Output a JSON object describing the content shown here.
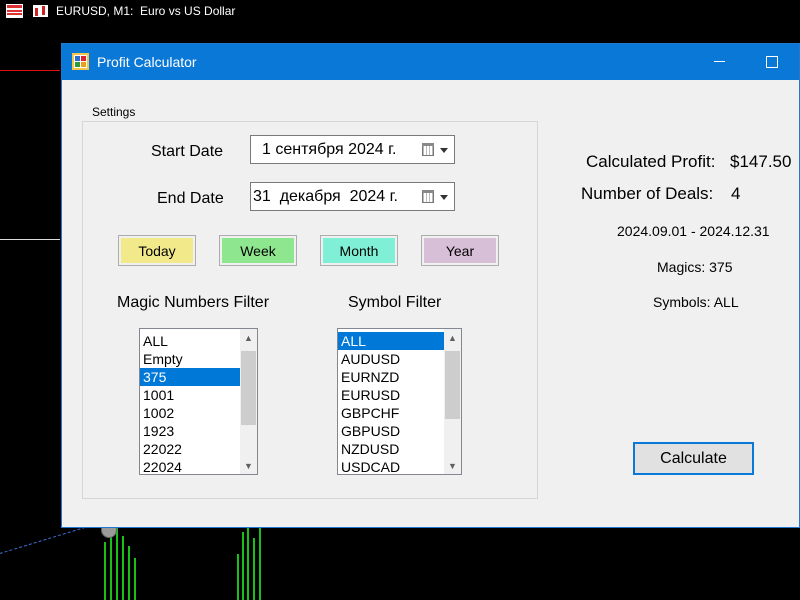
{
  "terminal": {
    "chart_title": "EURUSD, M1:  Euro vs US Dollar"
  },
  "window": {
    "title": "Profit Calculator",
    "controls": [
      "minimize",
      "maximize"
    ]
  },
  "settings": {
    "group_label": "Settings",
    "start_date_label": "Start Date",
    "start_date_value": "1 сентября 2024 г.",
    "end_date_label": "End Date",
    "end_date_value": "31  декабря  2024 г.",
    "quick_buttons": [
      {
        "label": "Today",
        "color": "#f2ea8a"
      },
      {
        "label": "Week",
        "color": "#8ee68e"
      },
      {
        "label": "Month",
        "color": "#7ff0d6"
      },
      {
        "label": "Year",
        "color": "#d8bfd8"
      }
    ],
    "magic_filter": {
      "label": "Magic Numbers Filter",
      "items": [
        "ALL",
        "Empty",
        "375",
        "1001",
        "1002",
        "1923",
        "22022",
        "22024"
      ],
      "selected": "375"
    },
    "symbol_filter": {
      "label": "Symbol Filter",
      "items": [
        "ALL",
        "AUDUSD",
        "EURNZD",
        "EURUSD",
        "GBPCHF",
        "GBPUSD",
        "NZDUSD",
        "USDCAD"
      ],
      "selected": "ALL"
    }
  },
  "results": {
    "profit_label": "Calculated Profit:",
    "profit_value": "$147.50",
    "deals_label": "Number of Deals:",
    "deals_value": "4",
    "date_range": "2024.09.01 - 2024.12.31",
    "magics": "Magics: 375",
    "symbols": "Symbols: ALL"
  },
  "actions": {
    "calculate_label": "Calculate"
  }
}
